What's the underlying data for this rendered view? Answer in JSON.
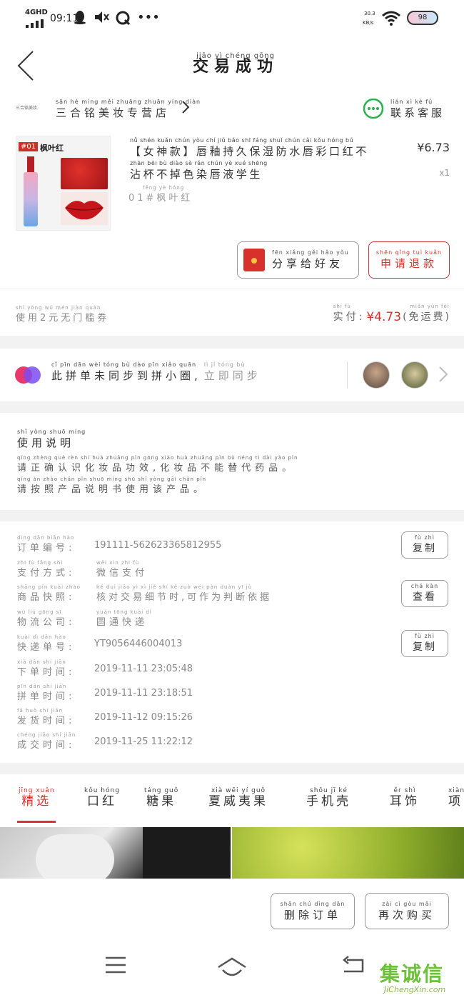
{
  "status_bar": {
    "network": "4GHD",
    "time": "09:11",
    "speed_top": "30.3",
    "speed_bottom": "KB/s",
    "battery": "98"
  },
  "header": {
    "title_pinyin": "jiāo yì chéng gōng",
    "title": "交易成功"
  },
  "shop": {
    "logo_text": "三合铭美妆",
    "name_pinyin": "sān hé míng měi zhuāng zhuān yíng diàn",
    "name": "三合铭美妆专营店",
    "contact_pinyin": "lián xì kè fú",
    "contact": "联系客服"
  },
  "product": {
    "thumb_badge": "#01",
    "thumb_label": "枫叶红",
    "title_pinyin_1": "nǚ shén kuǎn   chún yòu chí jiǔ bǎo shī fáng shuǐ chún cǎi kǒu hóng bú",
    "title_line1": "【女神款】唇釉持久保湿防水唇彩口红不",
    "title_pinyin_2": "zhān bēi bù diào sè rǎn chún yè xué shēng",
    "title_line2": "沾杯不掉色染唇液学生",
    "variant_pinyin": "fēng yè hóng",
    "variant": "01#枫叶红",
    "price": "¥6.73",
    "quantity": "x1"
  },
  "actions": {
    "share_pinyin": "fēn xiǎng gěi hǎo yǒu",
    "share": "分享给好友",
    "refund_pinyin": "shēn qǐng tuì kuǎn",
    "refund": "申请退款"
  },
  "coupon": {
    "pinyin": "shǐ yòng     wú mén jiàn quàn",
    "text": "使用2元无门槛券",
    "paid_pinyin": "shí fù",
    "paid_label": "实付:",
    "paid_value": "¥4.73",
    "shipping_pinyin": "miǎn yùn fèi",
    "shipping": "(免运费)"
  },
  "group": {
    "pinyin": "cǐ pīn dān wèi tóng bù dào pīn xiǎo quān",
    "text": "此拼单未同步到拼小圈,",
    "sync_pinyin": "lì jí tóng bù",
    "sync": "立即同步"
  },
  "usage": {
    "title_pinyin": "shǐ yòng shuō míng",
    "title": "使用说明",
    "line1_pinyin": "qǐng zhèng què rèn shí huà zhuāng pǐn gōng xiào     huà zhuāng pǐn bù néng tì dài yào pǐn",
    "line1": "请正确认识化妆品功效,化妆品不能替代药品。",
    "line2_pinyin": "qǐng àn zhào chǎn pǐn shuō míng shū shǐ yòng gāi chǎn pǐn",
    "line2": "请按照产品说明书使用该产品。"
  },
  "order": {
    "rows": [
      {
        "label_pinyin": "dìng dān biān hào",
        "label": "订单编号:",
        "value": "191111-562623365812955",
        "value_pinyin": ""
      },
      {
        "label_pinyin": "zhī fù fāng shì",
        "label": "支付方式:",
        "value": "微信支付",
        "value_pinyin": "wēi xìn zhī fù"
      },
      {
        "label_pinyin": "shāng pǐn kuài zhào",
        "label": "商品快照:",
        "value": "核对交易细节时,可作为判断依据",
        "value_pinyin": "hé duì jiāo yì xì jié shí   kě zuò wéi pàn duàn yī jù"
      },
      {
        "label_pinyin": "wù liú gōng sī",
        "label": "物流公司:",
        "value": "圆通快递",
        "value_pinyin": "yuán tōng kuài dì"
      },
      {
        "label_pinyin": "kuài dì dān hào",
        "label": "快递单号:",
        "value": "YT9056446004013",
        "value_pinyin": ""
      },
      {
        "label_pinyin": "xià dān shí jiān",
        "label": "下单时间:",
        "value": "2019-11-11 23:05:48",
        "value_pinyin": ""
      },
      {
        "label_pinyin": "pīn dān shí jiān",
        "label": "拼单时间:",
        "value": "2019-11-11 23:18:51",
        "value_pinyin": ""
      },
      {
        "label_pinyin": "fā huò shí jiān",
        "label": "发货时间:",
        "value": "2019-11-12 09:15:26",
        "value_pinyin": ""
      },
      {
        "label_pinyin": "chéng jiāo shí jiān",
        "label": "成交时间:",
        "value": "2019-11-25 11:22:12",
        "value_pinyin": ""
      }
    ],
    "copy_pinyin": "fù zhì",
    "copy": "复制",
    "view_pinyin": "chá kàn",
    "view": "查看"
  },
  "tabs": [
    {
      "pinyin": "jīng xuǎn",
      "label": "精选"
    },
    {
      "pinyin": "kǒu hóng",
      "label": "口红"
    },
    {
      "pinyin": "táng guǒ",
      "label": "糖果"
    },
    {
      "pinyin": "xià wēi yí guǒ",
      "label": "夏威夷果"
    },
    {
      "pinyin": "shǒu jī ké",
      "label": "手机壳"
    },
    {
      "pinyin": "ěr shì",
      "label": "耳饰"
    },
    {
      "pinyin": "xiàng",
      "label": "项"
    }
  ],
  "bottom_actions": {
    "delete_pinyin": "shān chú dìng dān",
    "delete": "删除订单",
    "rebuy_pinyin": "zài cì gòu mǎi",
    "rebuy": "再次购买"
  },
  "watermark": {
    "text": "集诚信",
    "url": "JiChengXin.com"
  },
  "colors": {
    "accent": "#d6332b",
    "wechat_green": "#2bb24c",
    "divider": "#f2f2f2"
  }
}
